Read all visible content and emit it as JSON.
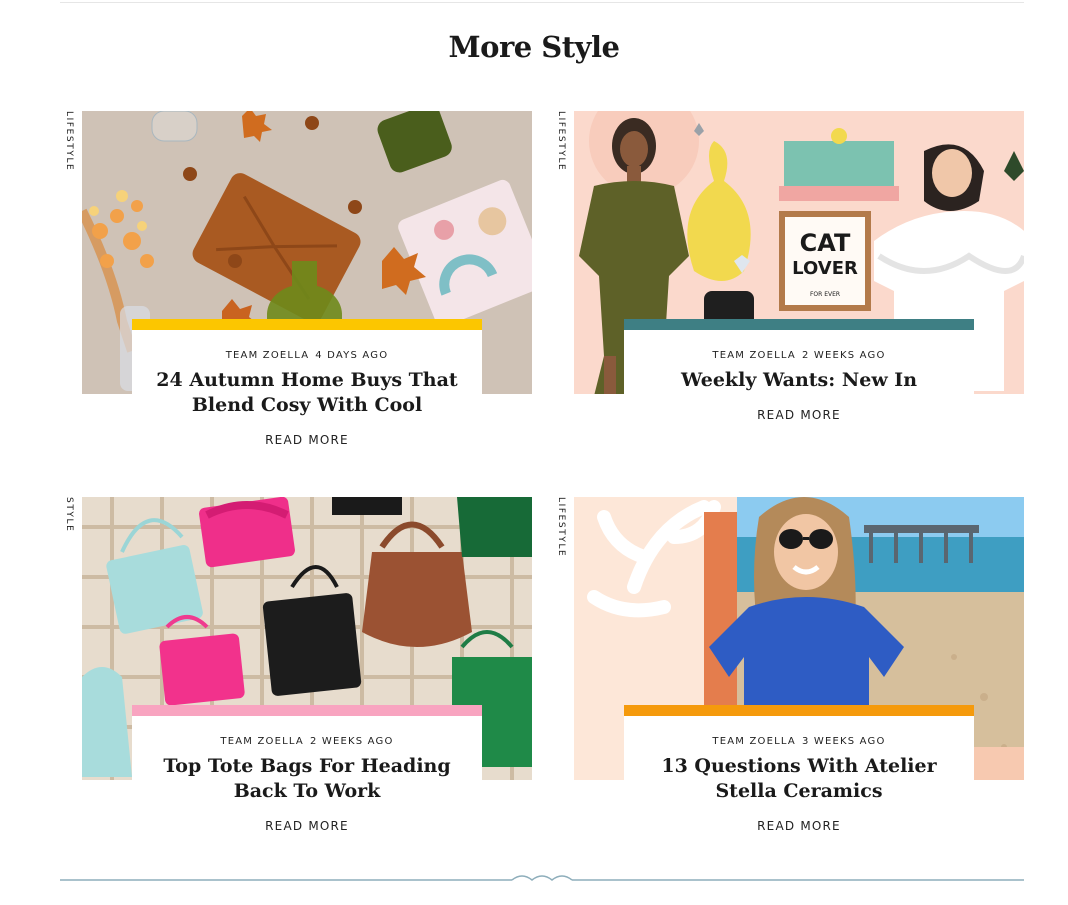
{
  "section": {
    "title": "More Style"
  },
  "articles": [
    {
      "category": "Lifestyle",
      "author": "Team Zoella",
      "date": "4 days ago",
      "title": "24 Autumn Home Buys That Blend Cosy With Cool",
      "read_more": "Read More",
      "accent_color": "#fcc600",
      "image": "autumn-home-collage"
    },
    {
      "category": "Lifestyle",
      "author": "Team Zoella",
      "date": "2 weeks ago",
      "title": "Weekly Wants: New In",
      "read_more": "Read More",
      "accent_color": "#3e7f84",
      "image": "weekly-wants-collage",
      "image_text": [
        "CAT",
        "LOVER",
        "FOR EVER"
      ]
    },
    {
      "category": "Style",
      "author": "Team Zoella",
      "date": "2 weeks ago",
      "title": "Top Tote Bags For Heading Back To Work",
      "read_more": "Read More",
      "accent_color": "#f8a4c0",
      "image": "tote-bags-collage"
    },
    {
      "category": "Lifestyle",
      "author": "Team Zoella",
      "date": "3 weeks ago",
      "title": "13 Questions With Atelier Stella Ceramics",
      "read_more": "Read More",
      "accent_color": "#f59a0c",
      "image": "beach-portrait-photo"
    }
  ],
  "colors": {
    "divider": "#8eaebb",
    "text": "#1a1a1a"
  }
}
